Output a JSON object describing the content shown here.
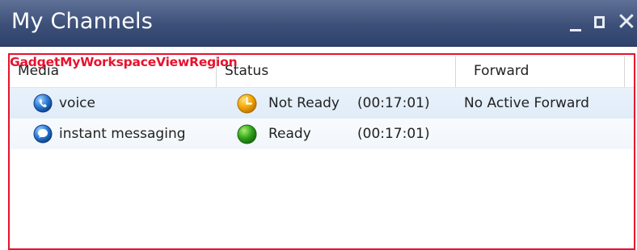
{
  "window": {
    "title": "My Channels",
    "controls": [
      "minimize",
      "maximize",
      "close"
    ],
    "close_glyph": "✕"
  },
  "region": {
    "label": "GadgetMyWorkspaceViewRegion",
    "color": "#e8122d"
  },
  "table": {
    "columns": [
      "Media",
      "Status",
      "Forward"
    ],
    "rows": [
      {
        "media": "voice",
        "media_icon": "phone-icon",
        "status": "Not Ready",
        "status_icon": "clock-icon",
        "status_color": "#f0a000",
        "time": "(00:17:01)",
        "forward": "No Active Forward"
      },
      {
        "media": "instant messaging",
        "media_icon": "chat-bubble-icon",
        "status": "Ready",
        "status_icon": "ready-icon",
        "status_color": "#2a9a1a",
        "time": "(00:17:01)",
        "forward": ""
      }
    ]
  }
}
